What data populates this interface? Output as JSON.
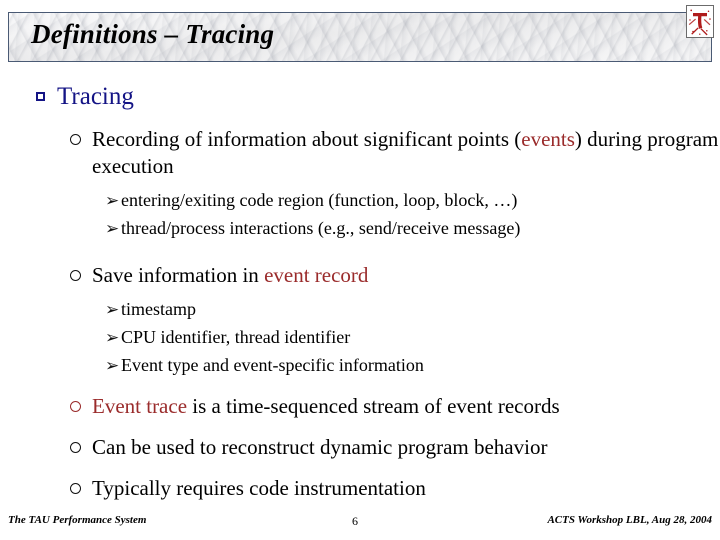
{
  "slide": {
    "title": "Definitions – Tracing",
    "logo": {
      "glyph": "τ",
      "color": "#b01c1c"
    }
  },
  "content": {
    "level1": {
      "label": "Tracing",
      "color": "#141485"
    },
    "items": [
      {
        "level": 2,
        "bullet_color": "#111111",
        "parts": [
          {
            "text": "Recording of information about significant points (",
            "color": "#000000"
          },
          {
            "text": "events",
            "color": "#9a2b2b"
          },
          {
            "text": ") during program execution",
            "color": "#000000"
          }
        ]
      },
      {
        "level": 3,
        "text": "entering/exiting code region (function, loop, block, …)"
      },
      {
        "level": 3,
        "text": "thread/process interactions (e.g., send/receive message)"
      },
      {
        "level": 2,
        "bullet_color": "#111111",
        "parts": [
          {
            "text": "Save information in ",
            "color": "#000000"
          },
          {
            "text": "event record",
            "color": "#9a2b2b"
          }
        ]
      },
      {
        "level": 3,
        "text": "timestamp"
      },
      {
        "level": 3,
        "text": "CPU identifier, thread identifier"
      },
      {
        "level": 3,
        "text": "Event type and event-specific information"
      },
      {
        "level": 2,
        "bullet_color": "#9a2b2b",
        "parts": [
          {
            "text": "Event trace",
            "color": "#9a2b2b"
          },
          {
            "text": " is a time-sequenced stream of event records",
            "color": "#000000"
          }
        ]
      },
      {
        "level": 2,
        "bullet_color": "#111111",
        "parts": [
          {
            "text": " Can be used to reconstruct dynamic program behavior",
            "color": "#000000"
          }
        ]
      },
      {
        "level": 2,
        "bullet_color": "#111111",
        "parts": [
          {
            "text": "Typically requires code instrumentation",
            "color": "#000000"
          }
        ]
      }
    ],
    "bullet_glyphs": {
      "level3_arrow": "➢"
    }
  },
  "footer": {
    "left": "The TAU Performance System",
    "center": "6",
    "right": "ACTS Workshop LBL, Aug 28, 2004"
  }
}
